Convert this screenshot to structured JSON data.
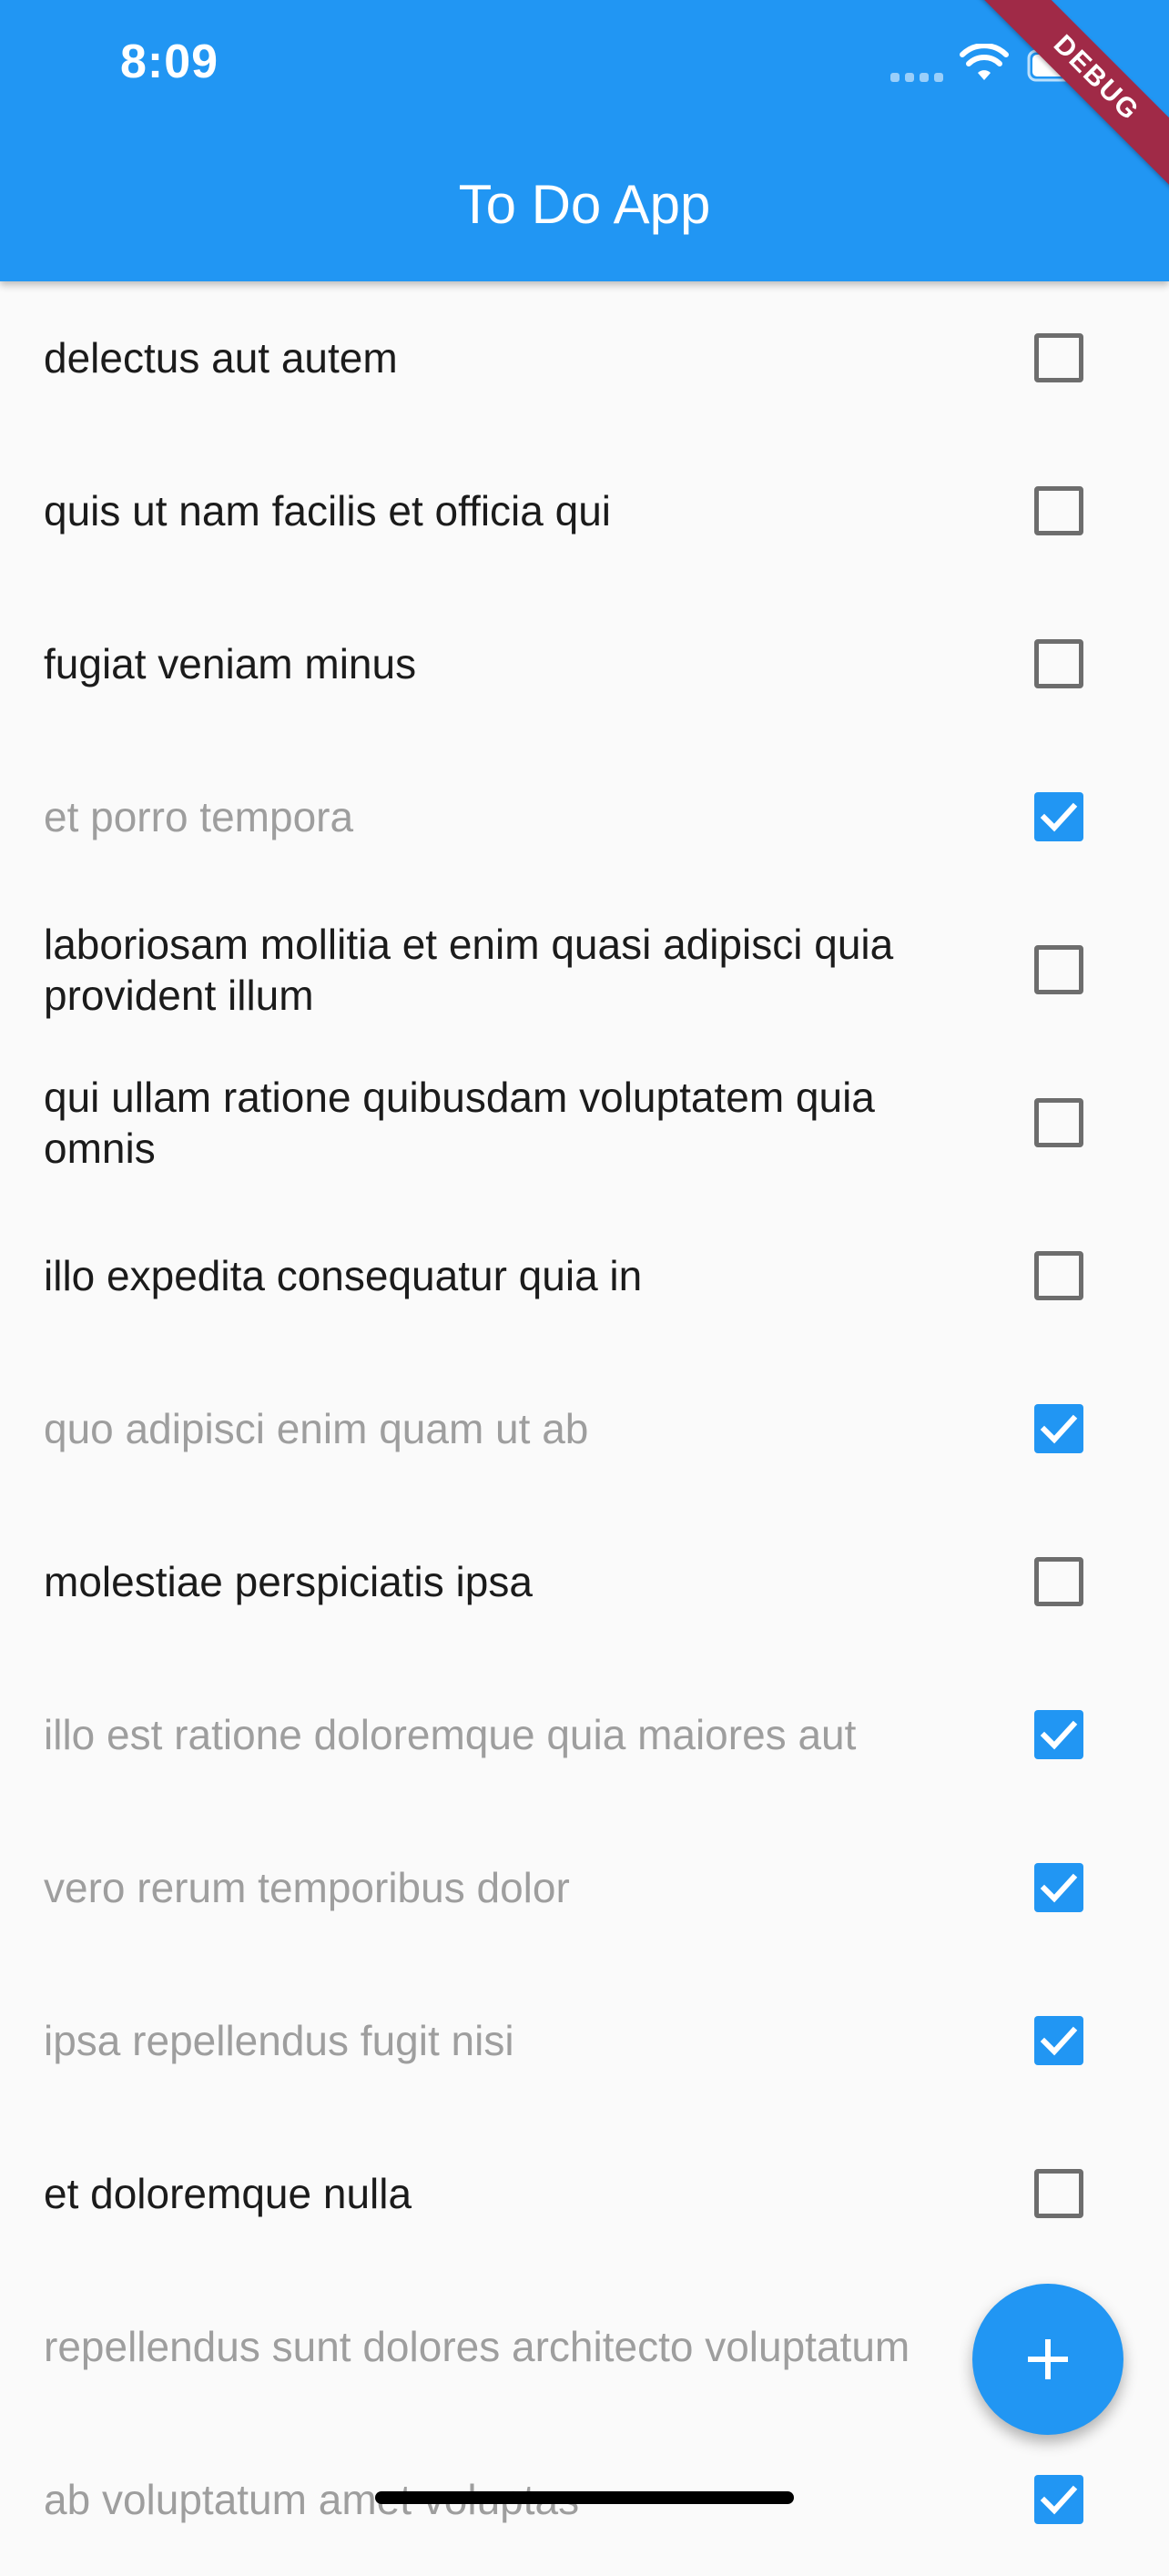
{
  "status_bar": {
    "time": "8:09",
    "icons": [
      "signal-icon",
      "wifi-icon",
      "battery-icon"
    ]
  },
  "debug_banner": "DEBUG",
  "app_bar": {
    "title": "To Do App",
    "color": "#2196f3"
  },
  "todos": [
    {
      "title": "delectus aut autem",
      "completed": false
    },
    {
      "title": "quis ut nam facilis et officia qui",
      "completed": false
    },
    {
      "title": "fugiat veniam minus",
      "completed": false
    },
    {
      "title": "et porro tempora",
      "completed": true
    },
    {
      "title": "laboriosam mollitia et enim quasi adipisci quia provident illum",
      "completed": false
    },
    {
      "title": "qui ullam ratione quibusdam voluptatem quia omnis",
      "completed": false
    },
    {
      "title": "illo expedita consequatur quia in",
      "completed": false
    },
    {
      "title": "quo adipisci enim quam ut ab",
      "completed": true
    },
    {
      "title": "molestiae perspiciatis ipsa",
      "completed": false
    },
    {
      "title": "illo est ratione doloremque quia maiores aut",
      "completed": true
    },
    {
      "title": "vero rerum temporibus dolor",
      "completed": true
    },
    {
      "title": "ipsa repellendus fugit nisi",
      "completed": true
    },
    {
      "title": "et doloremque nulla",
      "completed": false
    },
    {
      "title": "repellendus sunt dolores architecto voluptatum",
      "completed": true
    },
    {
      "title": "ab voluptatum amet voluptas",
      "completed": true
    }
  ],
  "fab": {
    "icon": "add-icon",
    "color": "#2196f3"
  }
}
